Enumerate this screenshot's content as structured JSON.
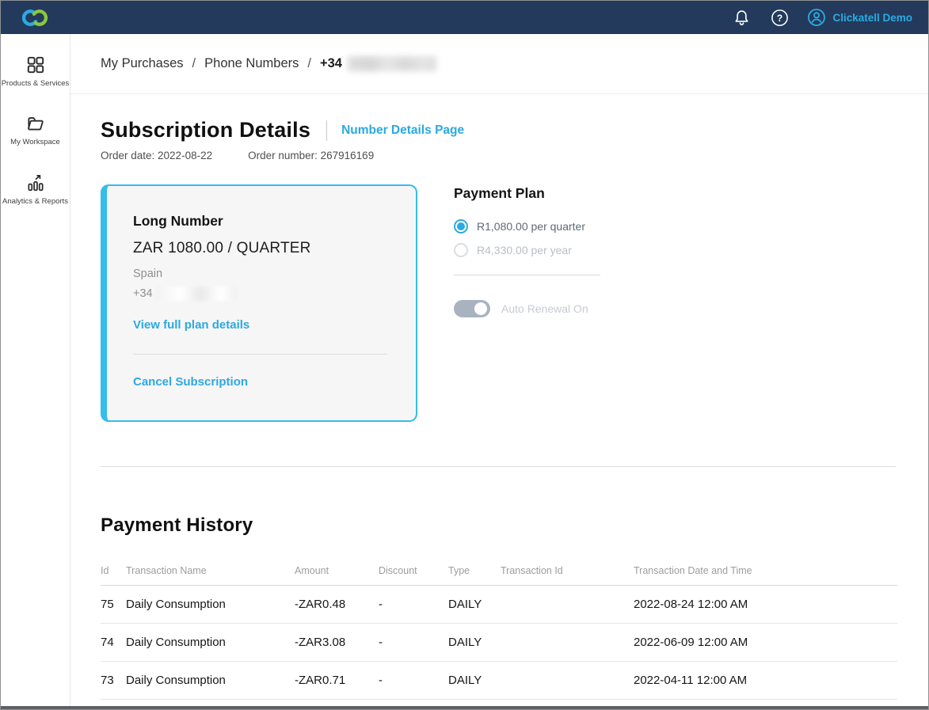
{
  "topbar": {
    "user_label": "Clickatell Demo"
  },
  "sidebar": {
    "items": [
      {
        "label": "Products & Services",
        "icon": "grid-icon"
      },
      {
        "label": "My Workspace",
        "icon": "folder-icon"
      },
      {
        "label": "Analytics & Reports",
        "icon": "bar-chart-icon"
      }
    ]
  },
  "breadcrumb": {
    "items": [
      "My Purchases",
      "Phone Numbers"
    ],
    "separator": "/",
    "current_prefix": "+34",
    "current_redacted": true
  },
  "subscription": {
    "title": "Subscription Details",
    "details_link": "Number Details Page",
    "order_date": "Order date: 2022-08-22",
    "order_number": "Order number: 267916169",
    "card": {
      "plan_name": "Long Number",
      "price": "ZAR  1080.00 / QUARTER",
      "country": "Spain",
      "phone_prefix": "+34",
      "view_link": "View full plan details",
      "cancel_link": "Cancel Subscription"
    },
    "payment_plan": {
      "title": "Payment Plan",
      "options": [
        {
          "label": "R1,080.00 per quarter",
          "selected": true
        },
        {
          "label": "R4,330.00 per year",
          "selected": false
        }
      ],
      "toggle_label": "Auto Renewal On",
      "auto_renewal_on": true
    }
  },
  "payment_history": {
    "title": "Payment History",
    "columns": [
      "Id",
      "Transaction Name",
      "Amount",
      "Discount",
      "Type",
      "Transaction Id",
      "Transaction Date and Time"
    ],
    "rows": [
      {
        "id": "75",
        "name": "Daily Consumption",
        "amount": "-ZAR0.48",
        "discount": "-",
        "type": "DAILY",
        "transaction_id": "",
        "datetime": "2022-08-24 12:00 AM"
      },
      {
        "id": "74",
        "name": "Daily Consumption",
        "amount": "-ZAR3.08",
        "discount": "-",
        "type": "DAILY",
        "transaction_id": "",
        "datetime": "2022-06-09 12:00 AM"
      },
      {
        "id": "73",
        "name": "Daily Consumption",
        "amount": "-ZAR0.71",
        "discount": "-",
        "type": "DAILY",
        "transaction_id": "",
        "datetime": "2022-04-11 12:00 AM"
      }
    ]
  },
  "colors": {
    "navbar": "#233A5C",
    "accent": "#29ABE2",
    "logo_green": "#8DC63F",
    "card_border": "#35BDEC"
  }
}
